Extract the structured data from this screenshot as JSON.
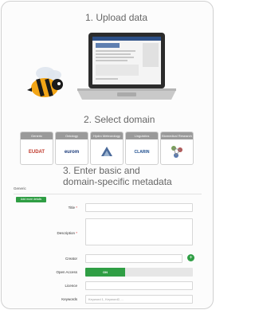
{
  "steps": {
    "upload": "1. Upload data",
    "select": "2. Select domain",
    "enter_line1": "3. Enter basic and",
    "enter_line2": "domain-specific metadata"
  },
  "domains": [
    {
      "header": "Generic",
      "logo": "EUDAT",
      "color": "#c0392b"
    },
    {
      "header": "Ontology",
      "logo": "eurom",
      "color": "#1a3a7a"
    },
    {
      "header": "Hydro Meteorology",
      "logo": "",
      "color": "#4a4a4a"
    },
    {
      "header": "Linguistics",
      "logo": "CLARIN",
      "color": "#1f4f8f"
    },
    {
      "header": "Biomedical Research",
      "logo": "",
      "color": "#6a8a4a"
    }
  ],
  "form": {
    "section_label": "Generic",
    "add_button": "Add more details",
    "title_label": "Title",
    "description_label": "Description",
    "creator_label": "Creator",
    "open_access_label": "Open Access",
    "open_access_value": "ON",
    "licence_label": "Licence",
    "keywords_label": "Keywords",
    "keywords_placeholder": "Keyword 1, Keyword2, ...",
    "required_mark": "*"
  },
  "colors": {
    "accent_green": "#2f9e44"
  }
}
